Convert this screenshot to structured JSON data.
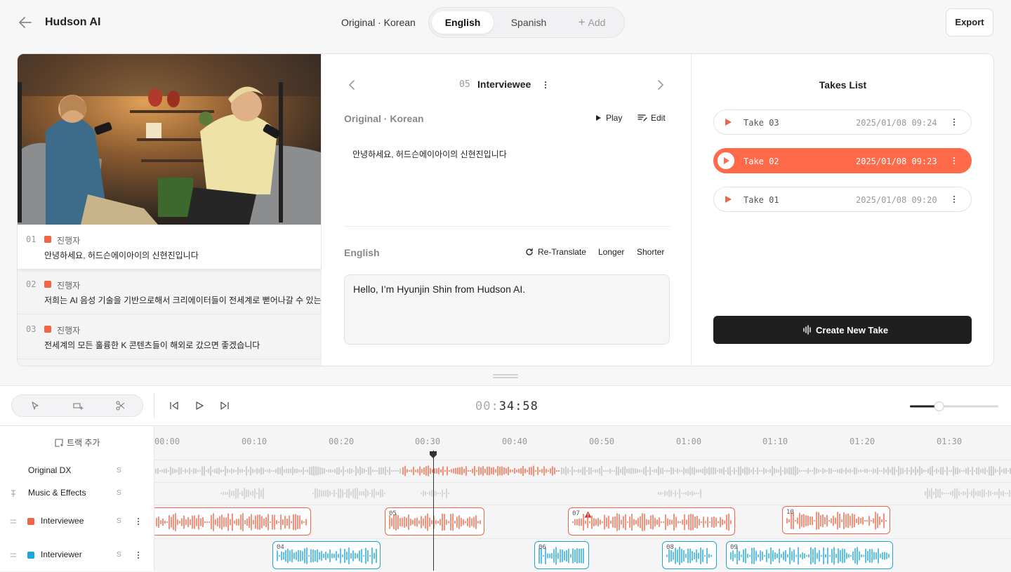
{
  "header": {
    "app_title": "Hudson AI",
    "original_language": "Original · Korean",
    "language_tabs": [
      "English",
      "Spanish"
    ],
    "add_language": "Add",
    "export_label": "Export"
  },
  "segments": [
    {
      "num": "01",
      "speaker": "진행자",
      "text": "안녕하세요, 허드슨에이아이의 신현진입니다"
    },
    {
      "num": "02",
      "speaker": "진행자",
      "text": "저희는 AI 음성 기술을 기반으로해서 크리에이터들이 전세계로 뻗어나갈 수 있는"
    },
    {
      "num": "03",
      "speaker": "진행자",
      "text": "전세계의 모든 훌륭한 K 콘텐츠들이 해외로 갔으면 좋겠습니다"
    }
  ],
  "editor": {
    "segment_id": "05",
    "segment_title": "Interviewee",
    "original_label": "Original · Korean",
    "play_label": "Play",
    "edit_label": "Edit",
    "original_text": "안녕하세요, 허드슨에이아이의 신현진입니다",
    "translation_label": "English",
    "retranslate_label": "Re-Translate",
    "longer_label": "Longer",
    "shorter_label": "Shorter",
    "translation_text": "Hello, I’m Hyunjin Shin from Hudson AI."
  },
  "takes": {
    "title": "Takes List",
    "items": [
      {
        "name": "Take 03",
        "date": "2025/01/08 09:24",
        "selected": false
      },
      {
        "name": "Take 02",
        "date": "2025/01/08 09:23",
        "selected": true
      },
      {
        "name": "Take 01",
        "date": "2025/01/08 09:20",
        "selected": false
      }
    ],
    "create_label": "Create New Take"
  },
  "timeline": {
    "timecode_dim": "00:",
    "timecode": "34:58",
    "zoom_level": 0.33,
    "add_track_label": "트랙 추가",
    "ticks": [
      "00:00",
      "00:10",
      "00:20",
      "00:30",
      "00:40",
      "00:50",
      "01:00",
      "01:10",
      "01:20",
      "01:30"
    ],
    "tracks": [
      {
        "name": "Original DX",
        "solo": "S"
      },
      {
        "name": "Music & Effects",
        "solo": "S"
      },
      {
        "name": "Interviewee",
        "solo": "S",
        "color": "#f06446"
      },
      {
        "name": "Interviewer",
        "solo": "S",
        "color": "#1aa7d8"
      }
    ],
    "clips_interviewee": [
      "",
      "05",
      "07",
      "10"
    ],
    "clips_interviewer": [
      "04",
      "06",
      "08",
      "09"
    ]
  },
  "colors": {
    "accent": "#ff6b4a",
    "speaker_red": "#f06446",
    "speaker_blue": "#1aa7d8"
  }
}
